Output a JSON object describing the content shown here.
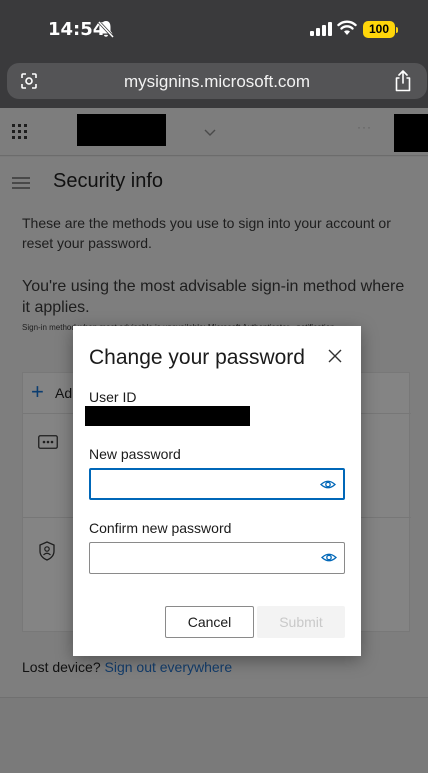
{
  "status_bar": {
    "time": "14:54",
    "battery": "100",
    "icons": [
      "bell-slash-icon",
      "signal-icon",
      "wifi-icon",
      "battery-icon"
    ]
  },
  "browser": {
    "url": "mysignins.microsoft.com",
    "icons": [
      "reader-icon",
      "share-icon"
    ]
  },
  "page": {
    "title": "Security info",
    "description": "These are the methods you use to sign into your account or reset your password.",
    "advisory": "You're using the most advisable sign-in method where it applies.",
    "advisory_small": "Sign-in method when most advisable is unavailable: Microsoft Authenticator - notification",
    "add_method_label": "Ad",
    "lost_device": "Lost device?",
    "sign_out_link": "Sign out everywhere"
  },
  "modal": {
    "title": "Change your password",
    "user_id_label": "User ID",
    "new_password_label": "New password",
    "new_password_value": "",
    "confirm_password_label": "Confirm new password",
    "confirm_password_value": "",
    "cancel_label": "Cancel",
    "submit_label": "Submit"
  },
  "colors": {
    "accent": "#0067b8",
    "overlay": "#7e7e7e",
    "battery": "#ffd60a"
  }
}
